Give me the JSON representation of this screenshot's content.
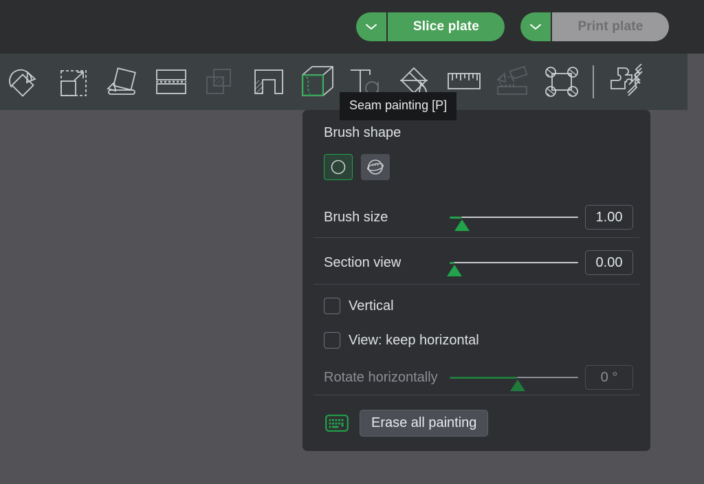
{
  "topbar": {
    "slice_plate": {
      "label": "Slice plate",
      "chevron_icon": "chevron-down-icon",
      "color": "#4aa159"
    },
    "print_plate": {
      "label": "Print plate",
      "chevron_icon": "chevron-down-icon",
      "color": "#9a9a9c",
      "disabled": true
    }
  },
  "toolbar": {
    "tools": [
      {
        "name": "auto-orient-icon"
      },
      {
        "name": "scale-to-fit-icon"
      },
      {
        "name": "place-on-face-icon"
      },
      {
        "name": "cut-tool-icon"
      },
      {
        "name": "mesh-boolean-icon"
      },
      {
        "name": "support-painting-icon"
      },
      {
        "name": "seam-painting-icon",
        "selected": true
      },
      {
        "name": "text-emboss-icon"
      },
      {
        "name": "fill-color-icon"
      },
      {
        "name": "measure-icon"
      },
      {
        "name": "assembly-icon"
      },
      {
        "name": "fuzzy-skin-icon"
      },
      {
        "name": "separator"
      },
      {
        "name": "split-to-parts-icon"
      }
    ]
  },
  "tooltip": {
    "text": "Seam painting [P]"
  },
  "panel": {
    "brush_shape": {
      "title": "Brush shape",
      "options": [
        {
          "name": "circle-brush-icon",
          "selected": true
        },
        {
          "name": "sphere-brush-icon",
          "selected": false
        }
      ]
    },
    "brush_size": {
      "label": "Brush size",
      "value": "1.00",
      "fill_percent": 9,
      "thumb_percent": 10
    },
    "section_view": {
      "label": "Section view",
      "value": "0.00",
      "fill_percent": 2,
      "thumb_percent": 2
    },
    "vertical": {
      "label": "Vertical",
      "checked": false
    },
    "keep_horizontal": {
      "label": "View: keep horizontal",
      "checked": false
    },
    "rotate_horizontally": {
      "label": "Rotate horizontally",
      "value": "0 °",
      "fill_percent": 52,
      "thumb_percent": 52,
      "disabled": true
    },
    "erase": {
      "label": "Erase all painting",
      "shortcut_icon": "keyboard-icon"
    }
  },
  "colors": {
    "accent_green": "#22a24a",
    "button_green": "#4aa159",
    "panel_bg": "#2d2f33",
    "toolbar_bg": "#3b4042",
    "topbar_bg": "#2c2e2f",
    "viewport_bg": "#525257",
    "tooltip_bg": "#18191a"
  }
}
